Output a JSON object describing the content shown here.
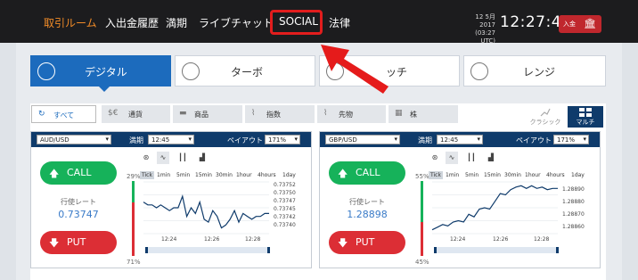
{
  "nav": {
    "items": [
      {
        "label": "取引ルーム",
        "active": true
      },
      {
        "label": "入出金履歴",
        "active": false
      },
      {
        "label": "満期",
        "active": false
      },
      {
        "label": "ライブチャット",
        "active": false
      },
      {
        "label": "SOCIAL",
        "active": false
      },
      {
        "label": "法律",
        "active": false
      }
    ],
    "date_line1": "12 5月 2017",
    "date_line2": "(03:27 UTC)",
    "clock": "12:27:44",
    "deposit_label": "入金",
    "deposit_icon": "bank-icon"
  },
  "modes": [
    {
      "label": "デジタル",
      "icon": "dial-icon",
      "active": true
    },
    {
      "label": "ターボ",
      "icon": "clock-icon",
      "active": false
    },
    {
      "label": "ッチ",
      "icon": "touch-icon",
      "active": false
    },
    {
      "label": "レンジ",
      "icon": "range-icon",
      "active": false
    }
  ],
  "categories": [
    {
      "label": "すべて",
      "icon": "refresh-icon",
      "active": true
    },
    {
      "label": "通貨",
      "icon": "currency-icon",
      "active": false
    },
    {
      "label": "商品",
      "icon": "commodity-icon",
      "active": false
    },
    {
      "label": "指数",
      "icon": "index-icon",
      "active": false
    },
    {
      "label": "先物",
      "icon": "futures-icon",
      "active": false
    },
    {
      "label": "株",
      "icon": "stock-icon",
      "active": false
    }
  ],
  "views": {
    "classic": "クラシック",
    "multi": "マルチ"
  },
  "cards": [
    {
      "pair": "AUD/USD",
      "expiry_label": "満期",
      "expiry": "12:45",
      "payout_label": "ペイアウト",
      "payout": "171%",
      "call": "CALL",
      "put": "PUT",
      "rate_label": "行使レート",
      "rate": "0.73747",
      "pct_top": "29%",
      "pct_bottom": "71%",
      "red_fraction": 0.71,
      "timeframes": [
        "Tick",
        "1min",
        "5min",
        "15min",
        "30min",
        "1hour",
        "4hours",
        "1day"
      ],
      "chart_data": {
        "type": "line",
        "y_ticks": [
          "0.73752",
          "0.73750",
          "0.73747",
          "0.73745",
          "0.73742",
          "0.73740"
        ],
        "x_ticks": [
          "12:24",
          "12:26",
          "12:28"
        ],
        "ylim": [
          0.73738,
          0.73756
        ],
        "values": [
          0.73749,
          0.73748,
          0.73748,
          0.73747,
          0.73748,
          0.73747,
          0.73746,
          0.73747,
          0.73747,
          0.73751,
          0.73744,
          0.73747,
          0.73745,
          0.73749,
          0.73743,
          0.73742,
          0.73746,
          0.73744,
          0.7374,
          0.73741,
          0.73743,
          0.73746,
          0.73742,
          0.73745,
          0.73744,
          0.73743,
          0.73744,
          0.73744,
          0.73745,
          0.73745
        ]
      }
    },
    {
      "pair": "GBP/USD",
      "expiry_label": "満期",
      "expiry": "12:45",
      "payout_label": "ペイアウト",
      "payout": "171%",
      "call": "CALL",
      "put": "PUT",
      "rate_label": "行使レート",
      "rate": "1.28898",
      "pct_top": "55%",
      "pct_bottom": "45%",
      "red_fraction": 0.45,
      "timeframes": [
        "Tick",
        "1min",
        "5min",
        "15min",
        "30min",
        "1hour",
        "4hours",
        "1day"
      ],
      "chart_data": {
        "type": "line",
        "y_ticks": [
          "1.28890",
          "1.28880",
          "1.28870",
          "1.28860"
        ],
        "x_ticks": [
          "12:24",
          "12:26",
          "12:28"
        ],
        "ylim": [
          1.28855,
          1.28895
        ],
        "values": [
          1.28858,
          1.2886,
          1.28862,
          1.28861,
          1.28864,
          1.28865,
          1.28864,
          1.2887,
          1.28868,
          1.28874,
          1.28875,
          1.28874,
          1.2888,
          1.28886,
          1.28885,
          1.28889,
          1.28891,
          1.28892,
          1.2889,
          1.28892,
          1.2889,
          1.28891,
          1.28889,
          1.2889,
          1.2889
        ]
      }
    }
  ]
}
